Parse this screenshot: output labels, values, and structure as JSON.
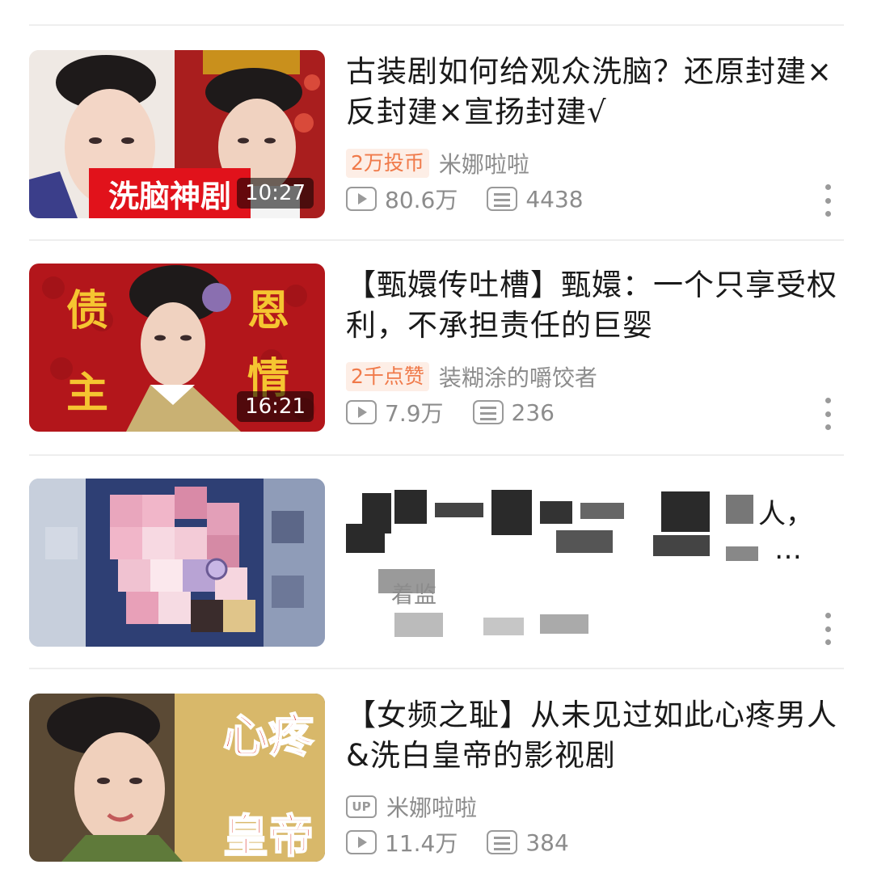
{
  "feed": {
    "items": [
      {
        "title": "古装剧如何给观众洗脑？还原封建×反封建×宣扬封建√",
        "duration": "10:27",
        "thumb_text": "洗脑神剧",
        "badge": "2万投币",
        "author": "米娜啦啦",
        "views": "80.6万",
        "danmaku": "4438"
      },
      {
        "title": "【甄嬛传吐槽】甄嬛：一个只享受权利，不承担责任的巨婴",
        "duration": "16:21",
        "thumb_text": [
          "债",
          "恩",
          "主",
          "情"
        ],
        "badge": "2千点赞",
        "author": "装糊涂的嚼饺者",
        "views": "7.9万",
        "danmaku": "236"
      },
      {
        "title_fragments": [
          "人，",
          "…",
          "着监"
        ],
        "censored": true
      },
      {
        "title": "【女频之耻】从未见过如此心疼男人&洗白皇帝的影视剧",
        "thumb_text": [
          "心疼",
          "皇帝"
        ],
        "up_label": "UP",
        "author": "米娜啦啦",
        "views": "11.4万",
        "danmaku": "384"
      }
    ]
  },
  "colors": {
    "badge_text": "#f07a4a",
    "badge_bg": "#fdeee6",
    "meta_gray": "#8c8c8c",
    "thumb2_red": "#b3161b",
    "thumb_text_gold": "#f5c531"
  }
}
